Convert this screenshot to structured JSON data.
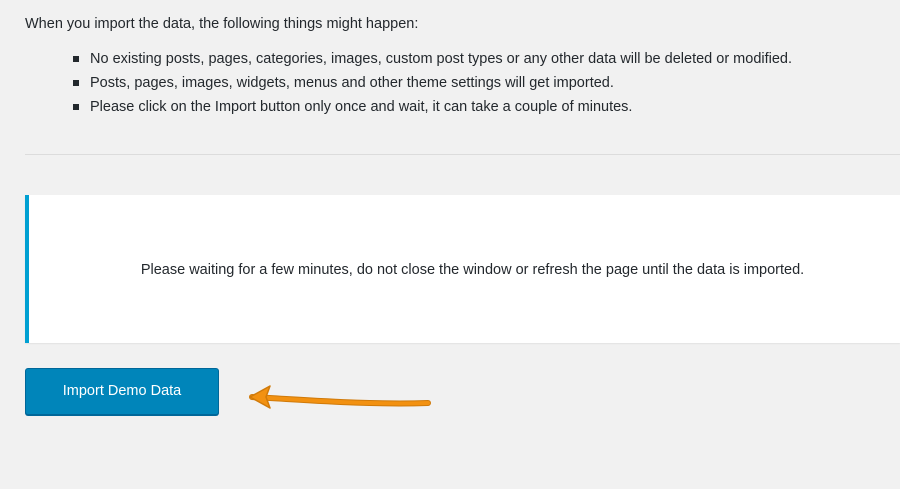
{
  "intro": {
    "text": "When you import the data, the following things might happen:"
  },
  "bullets": [
    "No existing posts, pages, categories, images, custom post types or any other data will be deleted or modified.",
    "Posts, pages, images, widgets, menus and other theme settings will get imported.",
    "Please click on the Import button only once and wait, it can take a couple of minutes."
  ],
  "notice": {
    "text": "Please waiting for a few minutes, do not close the window or refresh the page until the data is imported.",
    "accent_color": "#00a0d2"
  },
  "import_button": {
    "label": "Import Demo Data",
    "color": "#0085ba"
  },
  "annotation": {
    "arrow_icon": "arrow-left-icon",
    "arrow_color": "#f29111"
  }
}
